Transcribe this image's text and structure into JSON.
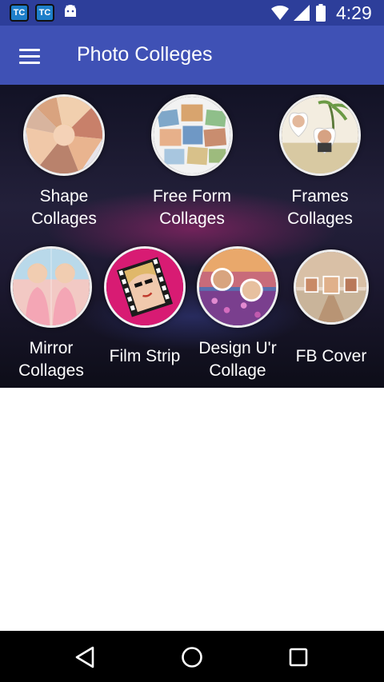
{
  "status_bar": {
    "app_icon_1": "TC",
    "app_icon_2": "TC",
    "time": "4:29"
  },
  "app_bar": {
    "title": "Photo Colleges",
    "menu_icon": "hamburger-menu-icon"
  },
  "tiles": [
    {
      "label": "Shape\nCollages",
      "icon": "shape-collage-thumb"
    },
    {
      "label": "Free Form\nCollages",
      "icon": "free-form-collage-thumb"
    },
    {
      "label": "Frames\nCollages",
      "icon": "frames-collage-thumb"
    },
    {
      "label": "Mirror\nCollages",
      "icon": "mirror-collage-thumb"
    },
    {
      "label": "Film Strip",
      "icon": "film-strip-thumb"
    },
    {
      "label": "Design U'r\nCollage",
      "icon": "design-collage-thumb"
    },
    {
      "label": "FB Cover",
      "icon": "fb-cover-thumb"
    }
  ],
  "nav": {
    "back_icon": "back-triangle-icon",
    "home_icon": "home-circle-icon",
    "recents_icon": "recents-square-icon"
  }
}
